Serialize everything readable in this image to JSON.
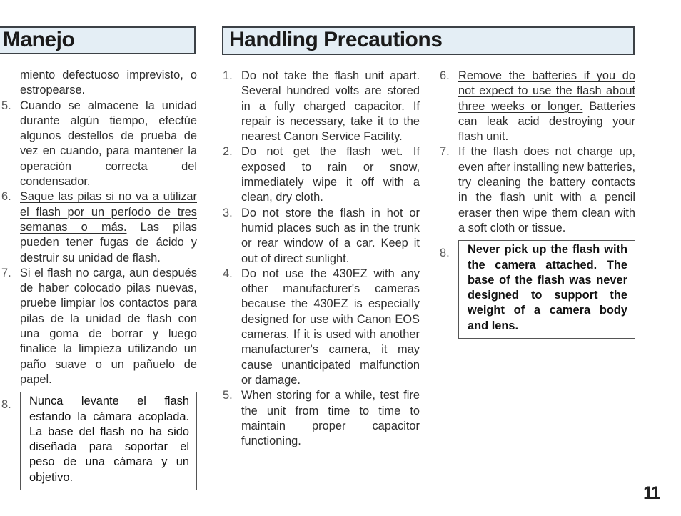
{
  "headers": {
    "spanish": "Manejo",
    "english": "Handling Precautions"
  },
  "spanish_column": {
    "continuation": "miento defectuoso imprevisto, o estropearse.",
    "items": [
      {
        "number": "5.",
        "text": "Cuando se almacene la unidad durante algún tiempo, efectúe algunos destellos de prueba de vez en cuando, para mantener la operación correcta del condensador."
      },
      {
        "number": "6.",
        "underlined": "Saque las pilas si no va a utilizar el flash por un período de tres semanas o más.",
        "text": " Las pilas pueden tener fugas de ácido y destruir su unidad de flash."
      },
      {
        "number": "7.",
        "text": "Si el flash no carga, aun después de haber colocado pilas nuevas, pruebe limpiar los contactos para pilas de la unidad de flash con una goma de borrar y luego finalice la limpieza utilizando un paño suave o un pañuelo de papel."
      },
      {
        "number": "8.",
        "boxed": "Nunca levante el flash estando la cámara acoplada. La base del flash no ha sido diseñada para soportar el peso de una cámara y un objetivo."
      }
    ]
  },
  "english_column_1": {
    "items": [
      {
        "number": "1.",
        "text": "Do not take the flash unit apart. Several hundred volts are stored in a fully charged capacitor. If repair is necessary, take it to the nearest Canon Service Facility."
      },
      {
        "number": "2.",
        "text": "Do not get the flash wet. If exposed to rain or snow, immediately wipe it off with a clean, dry cloth."
      },
      {
        "number": "3.",
        "text": "Do not store the flash in hot or humid places such as in the trunk or rear window of a car. Keep it out of direct sunlight."
      },
      {
        "number": "4.",
        "text": "Do not use the 430EZ with any other manufacturer's cameras because the 430EZ is especially designed for use with Canon EOS cameras. If it is used with another manufacturer's camera, it may cause unanticipated malfunction or damage."
      },
      {
        "number": "5.",
        "text": "When storing for a while, test fire the unit from time to time to maintain proper capacitor functioning."
      }
    ]
  },
  "english_column_2": {
    "items": [
      {
        "number": "6.",
        "underlined": "Remove the batteries if you do not expect to use the flash about three weeks or longer.",
        "text": " Batteries can leak acid destroying your flash unit."
      },
      {
        "number": "7.",
        "text": "If the flash does not charge up, even after installing new batteries, try cleaning the battery contacts in the flash unit with a pencil eraser then wipe them clean with a soft cloth or tissue."
      },
      {
        "number": "8.",
        "boxed": "Never pick up the flash with the camera attached. The base of the flash was never designed to support the weight of a camera body and lens."
      }
    ]
  },
  "page_number": "11"
}
